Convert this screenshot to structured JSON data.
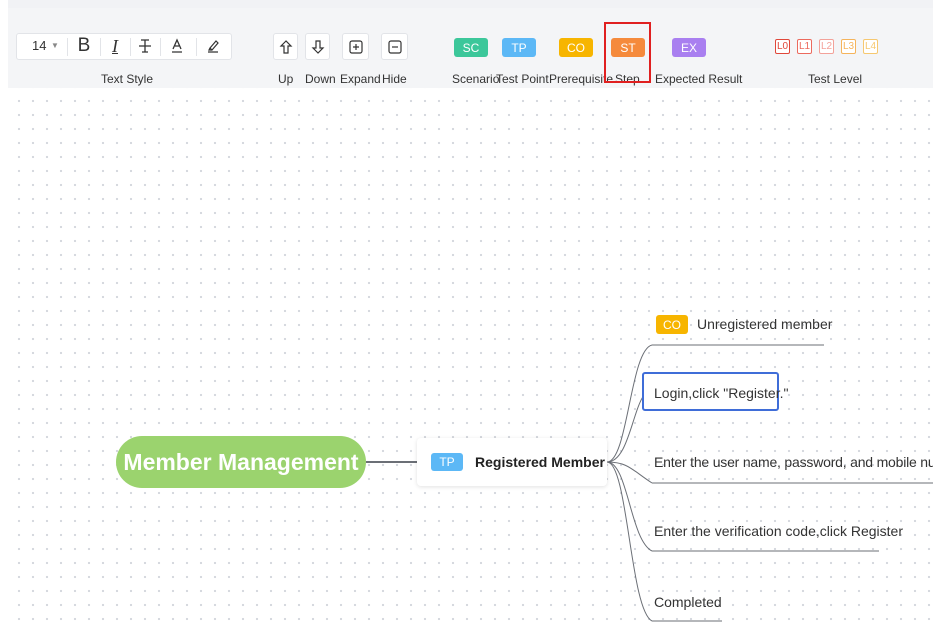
{
  "toolbar": {
    "font_size": "14",
    "text_style_label": "Text Style",
    "text_style_icons": [
      "bold-icon",
      "italic-icon",
      "strikethrough-icon",
      "font-color-icon",
      "highlight-pen-icon"
    ],
    "nav": {
      "up_label": "Up",
      "down_label": "Down",
      "expand_label": "Expand",
      "hide_label": "Hide"
    },
    "tags": {
      "sc": {
        "abbr": "SC",
        "label": "Scenario",
        "color": "#3cc79a"
      },
      "tp": {
        "abbr": "TP",
        "label": "Test Point",
        "color": "#5cb8f6"
      },
      "co": {
        "abbr": "CO",
        "label": "Prerequisite",
        "color": "#f7b500"
      },
      "st": {
        "abbr": "ST",
        "label": "Step",
        "color": "#f58a3c"
      },
      "ex": {
        "abbr": "EX",
        "label": "Expected Result",
        "color": "#a97ff0"
      }
    },
    "test_level_label": "Test Level",
    "levels": [
      {
        "text": "L0",
        "color": "#e0473a"
      },
      {
        "text": "L1",
        "color": "#ec6a5e"
      },
      {
        "text": "L2",
        "color": "#f3a29a"
      },
      {
        "text": "L3",
        "color": "#f5b45c"
      },
      {
        "text": "L4",
        "color": "#f6c870"
      }
    ]
  },
  "mindmap": {
    "root": "Member Management",
    "test_point": {
      "tag": "TP",
      "text": "Registered Member"
    },
    "children": [
      {
        "tag": "CO",
        "text": "Unregistered member"
      },
      {
        "text": "Login,click \"Register.\"",
        "selected": true
      },
      {
        "text": "Enter the user name, password, and mobile number."
      },
      {
        "text": "Enter the verification code,click Register"
      },
      {
        "text": "Completed"
      }
    ]
  }
}
